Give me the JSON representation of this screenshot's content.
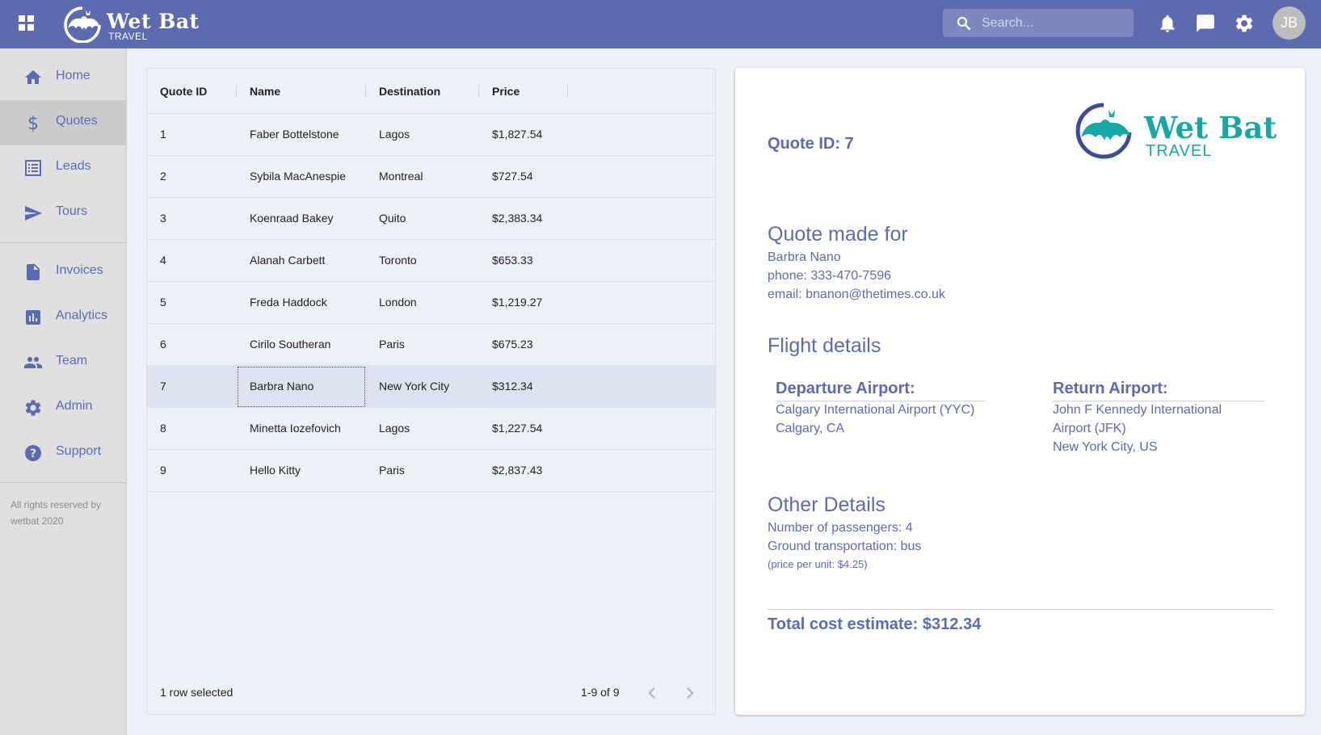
{
  "brand": {
    "name": "Wet Bat",
    "sub": "TRAVEL"
  },
  "search": {
    "placeholder": "Search..."
  },
  "user": {
    "initials": "JB"
  },
  "colors": {
    "topbar": "#5c6bb0",
    "accent": "#5c6bb0",
    "logo_teal": "#17a8a6",
    "sidebar": "#e0e0e0"
  },
  "sidebar": {
    "items": [
      {
        "label": "Home",
        "icon": "home-icon"
      },
      {
        "label": "Quotes",
        "icon": "dollar-icon",
        "active": true
      },
      {
        "label": "Leads",
        "icon": "list-icon"
      },
      {
        "label": "Tours",
        "icon": "send-icon"
      },
      {
        "label": "Invoices",
        "icon": "document-icon"
      },
      {
        "label": "Analytics",
        "icon": "chart-icon"
      },
      {
        "label": "Team",
        "icon": "people-icon"
      },
      {
        "label": "Admin",
        "icon": "gear-icon"
      },
      {
        "label": "Support",
        "icon": "help-icon"
      }
    ],
    "footer": "All rights reserved by wetbat 2020"
  },
  "table": {
    "columns": [
      "Quote ID",
      "Name",
      "Destination",
      "Price"
    ],
    "rows": [
      {
        "id": "1",
        "name": "Faber Bottelstone",
        "destination": "Lagos",
        "price": "$1,827.54"
      },
      {
        "id": "2",
        "name": "Sybila MacAnespie",
        "destination": "Montreal",
        "price": "$727.54"
      },
      {
        "id": "3",
        "name": "Koenraad Bakey",
        "destination": "Quito",
        "price": "$2,383.34"
      },
      {
        "id": "4",
        "name": "Alanah Carbett",
        "destination": "Toronto",
        "price": "$653.33"
      },
      {
        "id": "5",
        "name": "Freda Haddock",
        "destination": "London",
        "price": "$1,219.27"
      },
      {
        "id": "6",
        "name": "Cirilo Southeran",
        "destination": "Paris",
        "price": "$675.23"
      },
      {
        "id": "7",
        "name": "Barbra Nano",
        "destination": "New York City",
        "price": "$312.34"
      },
      {
        "id": "8",
        "name": "Minetta Iozefovich",
        "destination": "Lagos",
        "price": "$1,227.54"
      },
      {
        "id": "9",
        "name": "Hello Kitty",
        "destination": "Paris",
        "price": "$2,837.43"
      }
    ],
    "selected_row": 6,
    "footer_selected": "1 row selected",
    "pagination": "1-9 of 9"
  },
  "detail": {
    "quote_id": "Quote ID: 7",
    "made_for_heading": "Quote made for",
    "customer_name": "Barbra Nano",
    "phone": "phone: 333-470-7596",
    "email": "email: bnanon@thetimes.co.uk",
    "flight_heading": "Flight details",
    "departure_label": "Departure Airport:",
    "departure_airport": "Calgary International Airport (YYC)",
    "departure_city": "Calgary, CA",
    "return_label": "Return Airport:",
    "return_airport_line1": "John F Kennedy International",
    "return_airport_line2": "Airport (JFK)",
    "return_city": "New York City, US",
    "other_heading": "Other Details",
    "passengers": "Number of passengers: 4",
    "ground": "Ground transportation: bus",
    "unit_price": "(price per unit: $4.25)",
    "total": "Total cost estimate: $312.34"
  }
}
